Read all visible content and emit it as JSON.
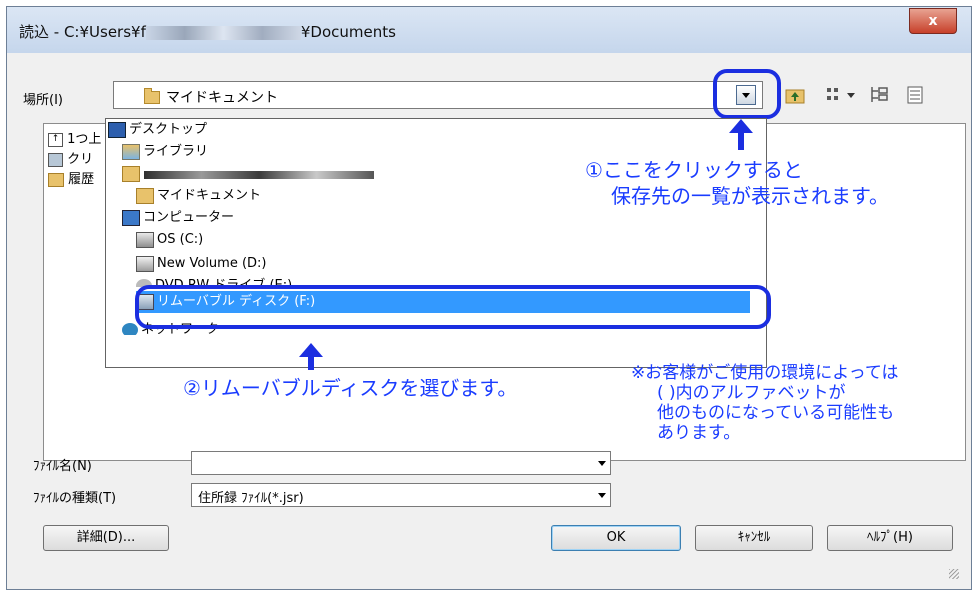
{
  "window": {
    "title_prefix": "読込 - C:¥Users¥f",
    "title_suffix": "¥Documents",
    "close_label": "x"
  },
  "location": {
    "label": "場所(I)",
    "value": "マイドキュメント"
  },
  "toolbar": {
    "icons": [
      "up-folder-icon",
      "view-menu-icon",
      "tree-icon",
      "details-icon"
    ]
  },
  "sidebar_list": [
    {
      "label": "1つ上",
      "icon": "up-icon"
    },
    {
      "label": "クリ",
      "icon": "clip-icon"
    },
    {
      "label": "履歴",
      "icon": "history-icon"
    }
  ],
  "dropdown": {
    "items": [
      {
        "label": "デスクトップ",
        "icon": "desktop-icon"
      },
      {
        "label": "ライブラリ",
        "icon": "library-icon"
      },
      {
        "label": "",
        "icon": "user-icon"
      },
      {
        "label": "マイドキュメント",
        "icon": "folder-icon"
      },
      {
        "label": "コンピューター",
        "icon": "computer-icon"
      },
      {
        "label": "OS (C:)",
        "icon": "drive-icon"
      },
      {
        "label": "New Volume (D:)",
        "icon": "drive-icon"
      },
      {
        "label": "DVD RW ドライブ (E:)",
        "icon": "dvd-icon"
      },
      {
        "label": "リムーバブル ディスク (F:)",
        "icon": "removable-icon"
      },
      {
        "label": "ネットワーク",
        "icon": "network-icon"
      }
    ],
    "selected_index": 8
  },
  "annotations": {
    "step1_line1": "①ここをクリックすると",
    "step1_line2": "保存先の一覧が表示されます。",
    "step2": "②リムーバブルディスクを選びます。",
    "note_line1": "※お客様がご使用の環境によっては",
    "note_line2": "(  )内のアルファベットが",
    "note_line3": "他のものになっている可能性も",
    "note_line4": "あります。"
  },
  "filename": {
    "label": "ﾌｧｲﾙ名(N)",
    "value": ""
  },
  "filetype": {
    "label": "ﾌｧｲﾙの種類(T)",
    "value": "住所録 ﾌｧｲﾙ(*.jsr)"
  },
  "buttons": {
    "details": "詳細(D)...",
    "ok": "OK",
    "cancel": "ｷｬﾝｾﾙ",
    "help": "ﾍﾙﾌﾟ(H)"
  },
  "colors": {
    "annotation_blue": "#1a3cff",
    "selection_blue": "#3399ff"
  }
}
